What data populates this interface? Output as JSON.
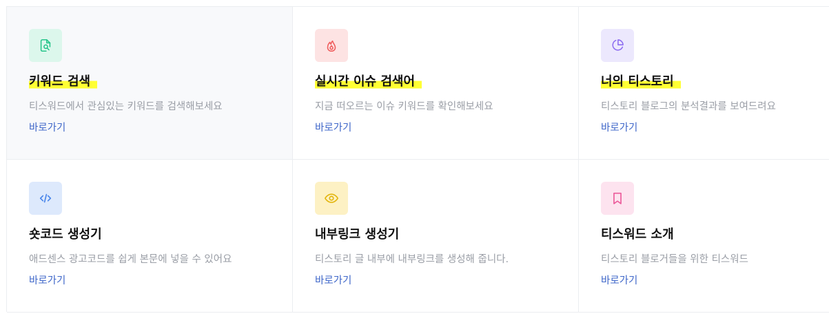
{
  "cards": [
    {
      "title": "키워드 검색",
      "description": "티스워드에서 관심있는 키워드를 검색해보세요",
      "link_label": "바로가기",
      "icon": "document-search-icon",
      "icon_bg": "#dcf7ec",
      "icon_color": "#25c48a",
      "highlighted_title": true
    },
    {
      "title": "실시간 이슈 검색어",
      "description": "지금 떠오르는 이슈 키워드를 확인해보세요",
      "link_label": "바로가기",
      "icon": "fire-icon",
      "icon_bg": "#fde3e3",
      "icon_color": "#ef5d5d",
      "highlighted_title": true
    },
    {
      "title": "너의 티스토리",
      "description": "티스토리 블로그의 분석결과를 보여드려요",
      "link_label": "바로가기",
      "icon": "pie-chart-icon",
      "icon_bg": "#ece8fd",
      "icon_color": "#8c6cf0",
      "highlighted_title": true
    },
    {
      "title": "숏코드 생성기",
      "description": "애드센스 광고코드를 쉽게 본문에 넣을 수 있어요",
      "link_label": "바로가기",
      "icon": "code-icon",
      "icon_bg": "#dde9fc",
      "icon_color": "#4a86ea",
      "highlighted_title": false
    },
    {
      "title": "내부링크 생성기",
      "description": "티스토리 글 내부에 내부링크를 생성해 줍니다.",
      "link_label": "바로가기",
      "icon": "eye-icon",
      "icon_bg": "#fdf1c4",
      "icon_color": "#e3b60f",
      "highlighted_title": false
    },
    {
      "title": "티스워드 소개",
      "description": "티스토리 블로거들을 위한 티스워드",
      "link_label": "바로가기",
      "icon": "bookmark-icon",
      "icon_bg": "#fde3ef",
      "icon_color": "#ec5a9a",
      "highlighted_title": false
    }
  ],
  "colors": {
    "link": "#3f67c9",
    "title_highlight": "#ffff33",
    "description": "#9a9ea6"
  }
}
